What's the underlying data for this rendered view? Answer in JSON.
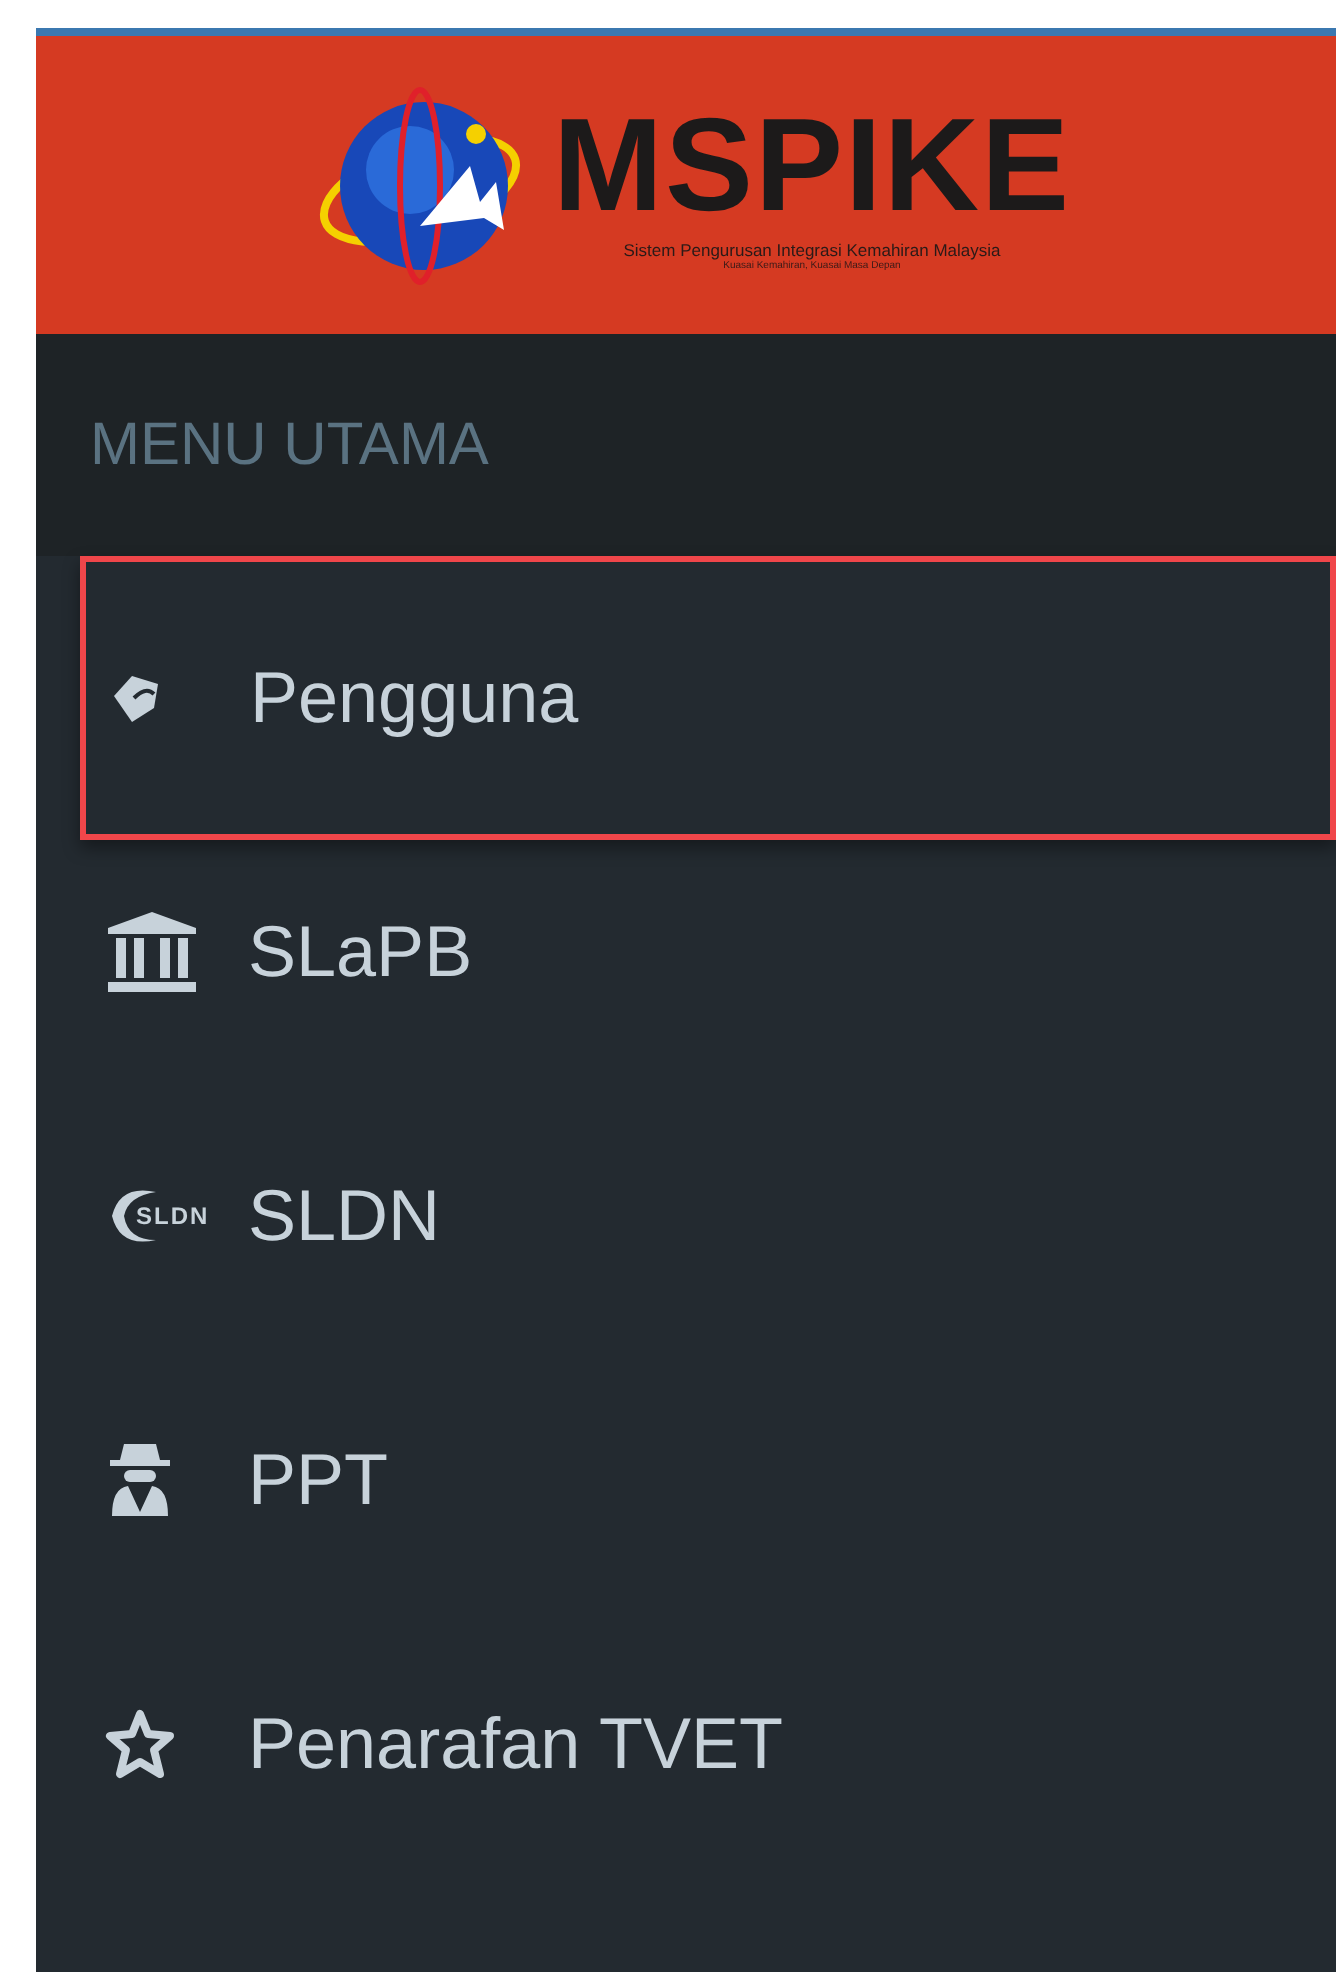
{
  "logo": {
    "name": "MSPIKE",
    "subtitle": "Sistem Pengurusan Integrasi Kemahiran Malaysia",
    "tagline": "Kuasai Kemahiran, Kuasai Masa Depan"
  },
  "menu": {
    "heading": "MENU UTAMA",
    "items": [
      {
        "label": "Pengguna",
        "selected": true
      },
      {
        "label": "SLaPB",
        "selected": false
      },
      {
        "label": "SLDN",
        "icon_text": "SLDN",
        "selected": false
      },
      {
        "label": "PPT",
        "selected": false
      },
      {
        "label": "Penarafan TVET",
        "selected": false
      }
    ]
  }
}
